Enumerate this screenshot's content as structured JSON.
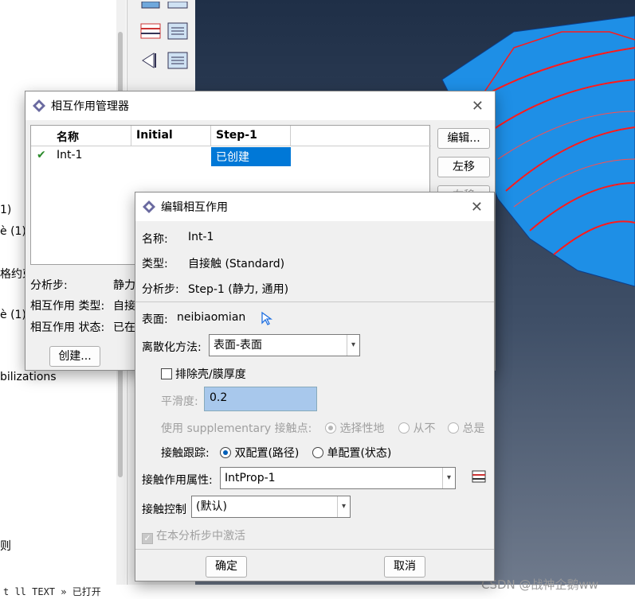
{
  "tree": {
    "items": [
      "1)",
      "è (1)",
      "格约束",
      "è (1)",
      "bilizations",
      "则"
    ]
  },
  "status_bar": {
    "text": "t ll      TEXT                                        » 已打开"
  },
  "watermark": "CSDN @战神企鹅ww",
  "manager": {
    "title": "相互作用管理器",
    "columns": [
      "名称",
      "Initial",
      "Step-1"
    ],
    "rows": [
      {
        "check": "✔",
        "name": "Int-1",
        "initial": "",
        "step1": "已创建"
      }
    ],
    "buttons": {
      "edit": "编辑...",
      "left": "左移",
      "right": "右移",
      "create": "创建..."
    },
    "info": {
      "step_label": "分析步:",
      "step_value": "静力",
      "type_label": "相互作用 类型:",
      "type_value": "自接",
      "state_label": "相互作用 状态:",
      "state_value": "已在"
    }
  },
  "editor": {
    "title": "编辑相互作用",
    "name_label": "名称:",
    "name_value": "Int-1",
    "type_label": "类型:",
    "type_value": "自接触 (Standard)",
    "step_label": "分析步:",
    "step_value": "Step-1 (静力, 通用)",
    "surface_label": "表面:",
    "surface_value": "neibiaomian",
    "discretization_label": "离散化方法:",
    "discretization_value": "表面-表面",
    "exclude_thickness_label": "排除壳/膜厚度",
    "smoothing_label": "平滑度:",
    "smoothing_value": "0.2",
    "supplementary_label": "使用 supplementary 接触点:",
    "supplementary_options": [
      "选择性地",
      "从不",
      "总是"
    ],
    "tracking_label": "接触跟踪:",
    "tracking_options": [
      "双配置(路径)",
      "单配置(状态)"
    ],
    "property_label": "接触作用属性:",
    "property_value": "IntProp-1",
    "control_label": "接触控制",
    "control_value": "(默认)",
    "activate_label": "在本分析步中激活",
    "ok": "确定",
    "cancel": "取消"
  },
  "colors": {
    "accent": "#0078d7",
    "model_blue": "#1e8fe6",
    "mesh_red": "#ff1a1a"
  }
}
